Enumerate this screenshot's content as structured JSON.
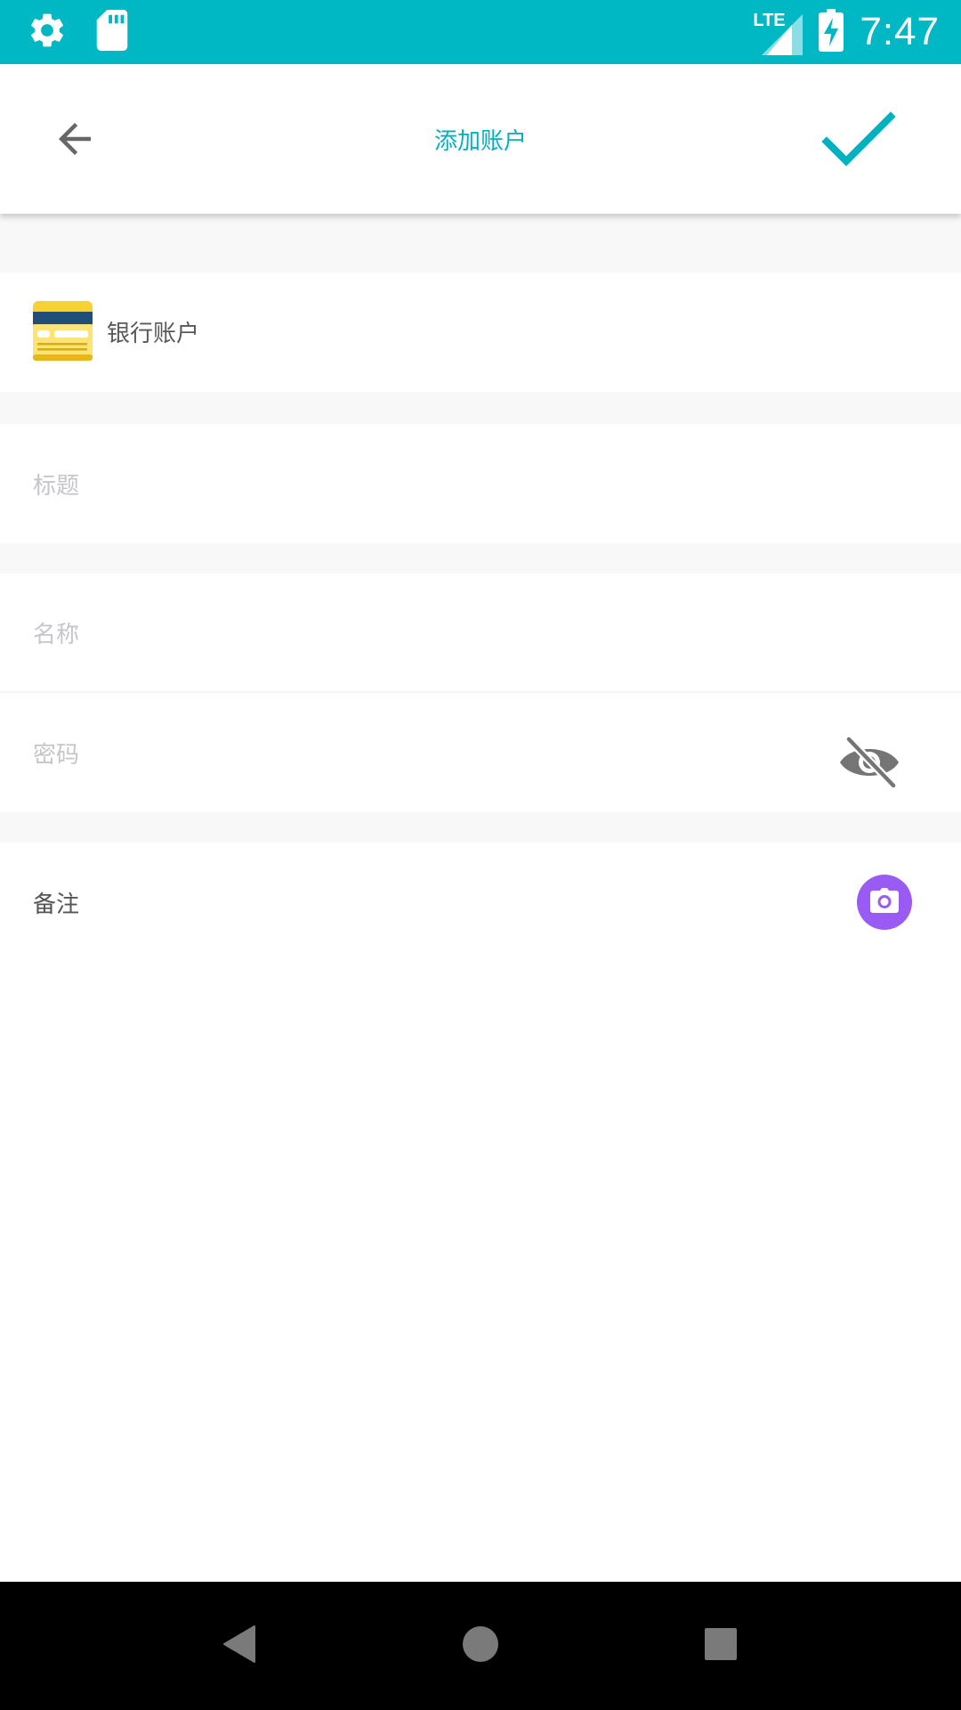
{
  "status_bar": {
    "time": "7:47",
    "left_icons": [
      "settings-icon",
      "sd-card-icon"
    ],
    "right_icons": [
      "lte-signal-icon",
      "battery-charging-icon"
    ],
    "network_label": "LTE"
  },
  "app_bar": {
    "title": "添加账户",
    "back_icon": "arrow-left-icon",
    "confirm_icon": "check-icon"
  },
  "account_type": {
    "label": "银行账户",
    "icon": "bank-card-icon"
  },
  "fields": {
    "title_placeholder": "标题",
    "name_placeholder": "名称",
    "password_placeholder": "密码",
    "password_toggle_icon": "eye-off-icon",
    "notes_label": "备注",
    "notes_camera_icon": "camera-icon"
  },
  "nav_bar": {
    "icons": [
      "back-triangle-icon",
      "home-circle-icon",
      "recents-square-icon"
    ]
  },
  "colors": {
    "accent": "#00b7c4",
    "title": "#00b1bf",
    "camera_button": "#9a5bf5",
    "placeholder": "#c4c6cc"
  }
}
